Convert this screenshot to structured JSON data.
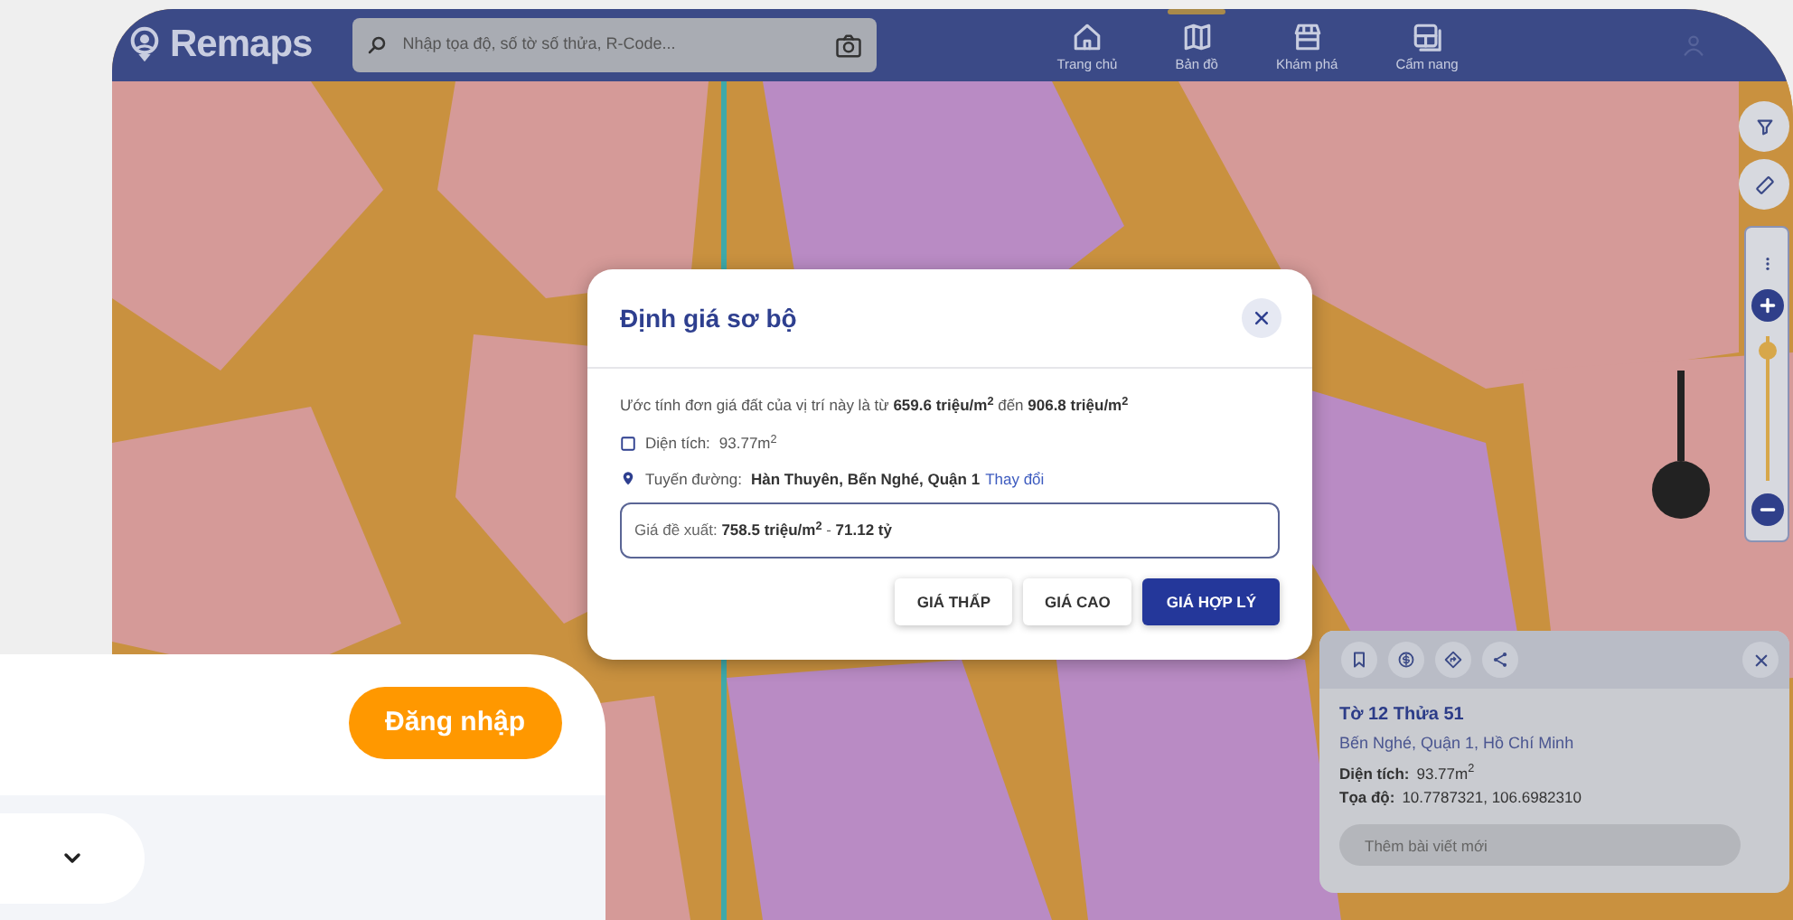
{
  "app": {
    "logo": "Remaps",
    "search": {
      "placeholder": "Nhập tọa độ, số tờ số thửa, R-Code..."
    },
    "nav": [
      {
        "label": "Trang chủ",
        "selected": false
      },
      {
        "label": "Bản đồ",
        "selected": true
      },
      {
        "label": "Khám phá",
        "selected": false
      },
      {
        "label": "Cẩm nang",
        "selected": false
      }
    ]
  },
  "map": {
    "kind": "picture",
    "zoom_slider": {
      "level": 0.9
    }
  },
  "valuation_dialog": {
    "title": "Định giá sơ bộ",
    "estimate": "Ước tính đơn giá đất của vị trí này là từ **659.6 triệu/m$^{2}$** đến **906.8 triệu/m$^{2}$**",
    "area_label": "Diện tích:",
    "area_value": "93.77m$^{2}$",
    "route_label": "Tuyến đường:",
    "route_value": "Hàn Thuyên, Bến Nghé, Quận 1",
    "change_link": "Thay đổi",
    "suggested_price": "Giá đề xuất: **758.5 triệu/m$^{2}$** - **71.12 tỷ**",
    "buttons": [
      {
        "label": "GIÁ THẤP",
        "selected": false
      },
      {
        "label": "GIÁ CAO",
        "selected": false
      },
      {
        "label": "GIÁ HỢP LÝ",
        "selected": true
      }
    ]
  },
  "parcel_card": {
    "title": "Tờ 12 Thửa 51",
    "address": "Bến Nghé, Quận 1, Hồ Chí Minh",
    "area_label": "Diện tích:",
    "area_value": "93.77m$^{2}$",
    "coord_label": "Tọa độ:",
    "coord_value": "10.7787321, 106.6982310",
    "post_placeholder": "Thêm bài viết mới"
  },
  "login_card": {
    "login_button": "Đăng nhập"
  }
}
